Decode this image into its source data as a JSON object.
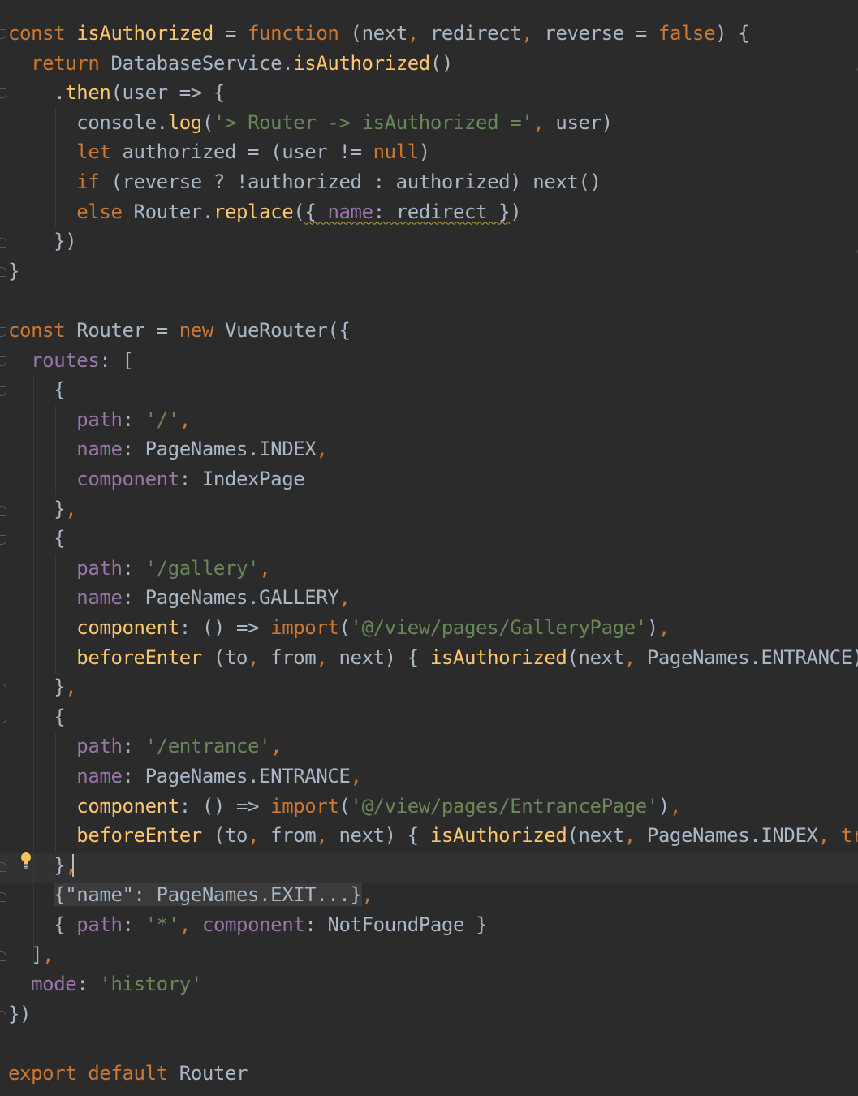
{
  "editor": {
    "language": "javascript",
    "theme_colors": {
      "background": "#2b2b2b",
      "keyword": "#cc7832",
      "function": "#ffc66d",
      "property": "#9876aa",
      "string": "#6a8759",
      "plain": "#a9b7c6"
    }
  },
  "code": {
    "l1": {
      "t1": "const",
      "t2": " ",
      "t3": "isAuthorized",
      "t4": " = ",
      "t5": "function",
      "t6": " (next",
      "t7": ",",
      "t8": " redirect",
      "t9": ",",
      "t10": " reverse = ",
      "t11": "false",
      "t12": ") {"
    },
    "l2": {
      "t1": "  ",
      "t2": "return",
      "t3": " DatabaseService.",
      "t4": "isAuthorized",
      "t5": "()"
    },
    "l3": {
      "t1": "    .",
      "t2": "then",
      "t3": "(user => {"
    },
    "l4": {
      "t1": "      console.",
      "t2": "log",
      "t3": "(",
      "t4": "'> Router -> isAuthorized ='",
      "t5": ",",
      "t6": " user)"
    },
    "l5": {
      "t1": "      ",
      "t2": "let",
      "t3": " authorized = (user != ",
      "t4": "null",
      "t5": ")"
    },
    "l6": {
      "t1": "      ",
      "t2": "if",
      "t3": " (reverse ? !authorized : authorized) next()"
    },
    "l7": {
      "t1": "      ",
      "t2": "else",
      "t3": " Router.",
      "t4": "replace",
      "t5": "(",
      "t6": "{ ",
      "t7": "name",
      "t8": ": redirect }",
      "t9": ")"
    },
    "l8": {
      "t1": "    })"
    },
    "l9": {
      "t1": "}"
    },
    "l11": {
      "t1": "const",
      "t2": " Router = ",
      "t3": "new",
      "t4": " VueRouter({"
    },
    "l12": {
      "t1": "  ",
      "t2": "routes",
      "t3": ": ["
    },
    "l13": {
      "t1": "    {"
    },
    "l14": {
      "t1": "      ",
      "t2": "path",
      "t3": ": ",
      "t4": "'/'",
      "t5": ","
    },
    "l15": {
      "t1": "      ",
      "t2": "name",
      "t3": ": PageNames.INDEX",
      "t4": ","
    },
    "l16": {
      "t1": "      ",
      "t2": "component",
      "t3": ": IndexPage"
    },
    "l17": {
      "t1": "    }",
      "t2": ","
    },
    "l18": {
      "t1": "    {"
    },
    "l19": {
      "t1": "      ",
      "t2": "path",
      "t3": ": ",
      "t4": "'/gallery'",
      "t5": ","
    },
    "l20": {
      "t1": "      ",
      "t2": "name",
      "t3": ": PageNames.GALLERY",
      "t4": ","
    },
    "l21": {
      "t1": "      ",
      "t2": "component",
      "t3": ": () => ",
      "t4": "import",
      "t5": "(",
      "t6": "'@/view/pages/GalleryPage'",
      "t7": ")",
      "t8": ","
    },
    "l22": {
      "t1": "      ",
      "t2": "beforeEnter",
      "t3": " (to",
      "t4": ",",
      "t5": " from",
      "t6": ",",
      "t7": " next) { ",
      "t8": "isAuthorized",
      "t9": "(next",
      "t10": ",",
      "t11": " PageNames.ENTRANCE) }"
    },
    "l23": {
      "t1": "    }",
      "t2": ","
    },
    "l24": {
      "t1": "    {"
    },
    "l25": {
      "t1": "      ",
      "t2": "path",
      "t3": ": ",
      "t4": "'/entrance'",
      "t5": ","
    },
    "l26": {
      "t1": "      ",
      "t2": "name",
      "t3": ": PageNames.ENTRANCE",
      "t4": ","
    },
    "l27": {
      "t1": "      ",
      "t2": "component",
      "t3": ": () => ",
      "t4": "import",
      "t5": "(",
      "t6": "'@/view/pages/EntrancePage'",
      "t7": ")",
      "t8": ","
    },
    "l28": {
      "t1": "      ",
      "t2": "beforeEnter",
      "t3": " (to",
      "t4": ",",
      "t5": " from",
      "t6": ",",
      "t7": " next) { ",
      "t8": "isAuthorized",
      "t9": "(next",
      "t10": ",",
      "t11": " PageNames.INDEX",
      "t12": ",",
      "t13": " ",
      "t14": "true",
      "t15": ")"
    },
    "l29": {
      "t1": "    }",
      "t2": ","
    },
    "l30": {
      "t1": "    ",
      "t2": "{\"name\": PageNames.EXIT...}",
      "t3": ","
    },
    "l31": {
      "t1": "    { ",
      "t2": "path",
      "t3": ": ",
      "t4": "'*'",
      "t5": ",",
      "t6": " ",
      "t7": "component",
      "t8": ": NotFoundPage }"
    },
    "l32": {
      "t1": "  ]",
      "t2": ","
    },
    "l33": {
      "t1": "  ",
      "t2": "mode",
      "t3": ": ",
      "t4": "'history'"
    },
    "l34": {
      "t1": "})"
    },
    "l36": {
      "t1": "export",
      "t2": " ",
      "t3": "default",
      "t4": " Router"
    }
  },
  "icons": {
    "intention_bulb": "lightbulb-icon"
  }
}
